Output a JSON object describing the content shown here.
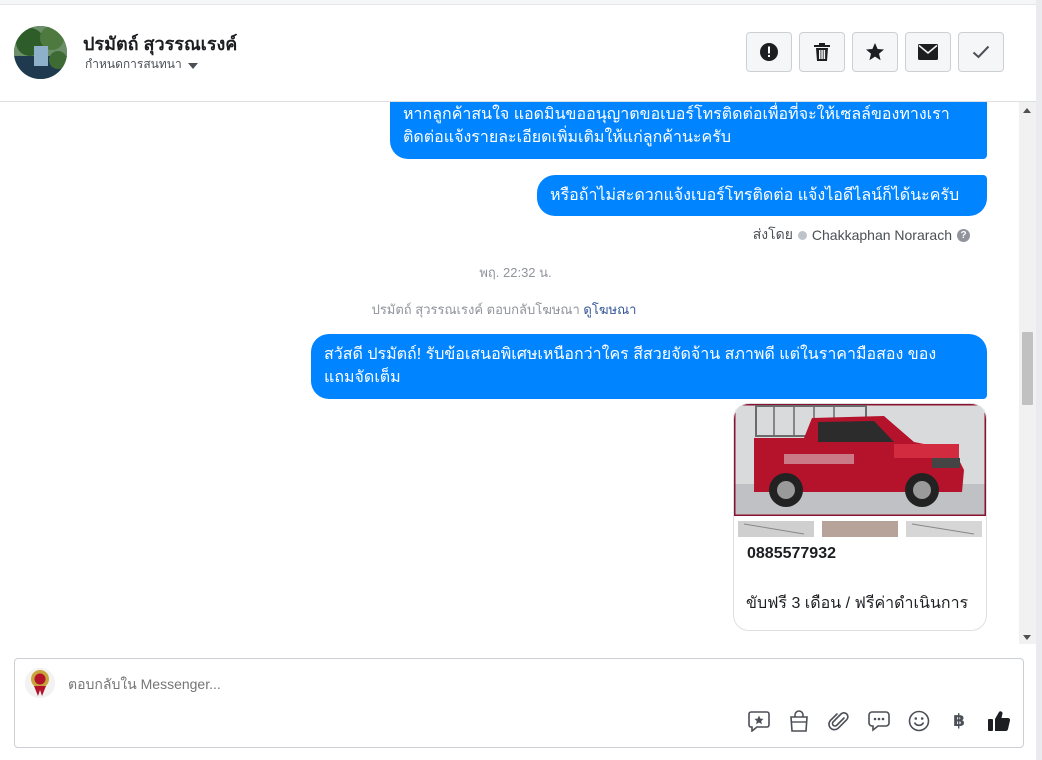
{
  "header": {
    "name": "ปรมัตถ์ สุวรรณเรงค์",
    "subtitle": "กำหนดการสนทนา",
    "actions": [
      "alert-icon",
      "trash-icon",
      "star-icon",
      "envelope-icon",
      "check-icon"
    ]
  },
  "conversation": {
    "messages": [
      {
        "text_line1": "หากลูกค้าสนใจ แอดมินขออนุญาตขอเบอร์โทรติดต่อเพื่อที่จะให้เซลล์ของทางเรา",
        "text_line2": "ติดต่อแจ้งรายละเอียดเพิ่มเติมให้แก่ลูกค้านะครับ"
      },
      {
        "text": "หรือถ้าไม่สะดวกแจ้งเบอร์โทรติดต่อ แจ้งไอดีไลน์ก็ได้นะครับ"
      },
      {
        "text_line1": "สวัสดี ปรมัตถ์! รับข้อเสนอพิเศษเหนือกว่าใคร สีสวยจัดจ้าน สภาพดี แต่ในราคามือสอง ของ",
        "text_line2": "แถมจัดเต็ม"
      }
    ],
    "sent_by_label": "ส่งโดย",
    "sent_by_name": "Chakkaphan Norarach",
    "timestamp": "พฤ. 22:32 น.",
    "reply_note": "ปรมัตถ์ สุวรรณเรงค์ ตอบกลับโฆษณา",
    "reply_link": "ดูโฆษณา",
    "ad_card": {
      "phone": "0885577932",
      "description": "ขับฟรี 3 เดือน / ฟรีค่าดำเนินการ"
    }
  },
  "composer": {
    "placeholder": "ตอบกลับใน Messenger...",
    "tools": [
      "saved-reply-icon",
      "shop-bag-icon",
      "paperclip-icon",
      "chat-bubble-icon",
      "emoji-icon",
      "baht-icon",
      "thumbs-up-icon"
    ],
    "baht_symbol": "฿"
  },
  "colors": {
    "bubble": "#0084ff",
    "link": "#365899",
    "muted": "#90949c"
  }
}
